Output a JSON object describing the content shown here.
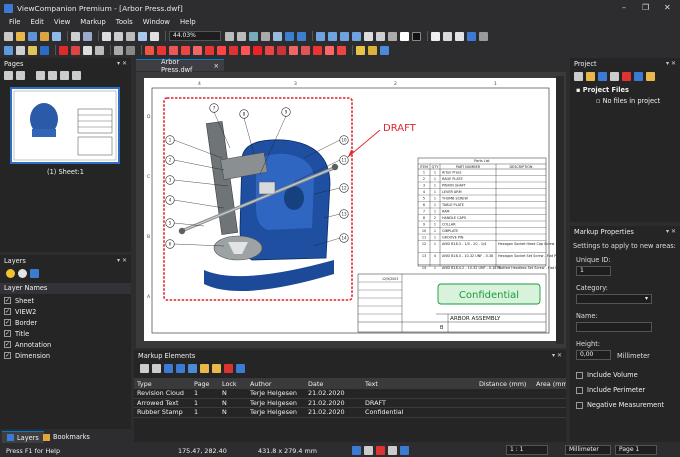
{
  "window": {
    "title": "ViewCompanion Premium - [Arbor Press.dwf]",
    "min": "–",
    "max": "❐",
    "close": "✕"
  },
  "menu": [
    "File",
    "Edit",
    "View",
    "Markup",
    "Tools",
    "Window",
    "Help"
  ],
  "toolbar": {
    "zoom_value": "44.03%"
  },
  "pages_panel": {
    "title": "Pages",
    "thumb_label": "(1) Sheet:1"
  },
  "layers_panel": {
    "title": "Layers",
    "column": "Layer Names",
    "layers": [
      "Sheet",
      "VIEW2",
      "Border",
      "Title",
      "Annotation",
      "Dimension"
    ]
  },
  "bottom_tabs": {
    "layers": "Layers",
    "bookmarks": "Bookmarks"
  },
  "document_tab": {
    "label": "Arbor Press.dwf",
    "close": "×"
  },
  "drawing": {
    "draft_label": "DRAFT",
    "confidential_label": "Confidential",
    "title_block_name": "ARBOR ASSEMBLY",
    "parts_list_title": "Parts List",
    "parts_headers": [
      "ITEM",
      "QTY",
      "PART NUMBER",
      "DESCRIPTION"
    ],
    "parts_rows": [
      [
        "1",
        "1",
        "Arbor Press",
        ""
      ],
      [
        "2",
        "1",
        "RAGE PLATE",
        ""
      ],
      [
        "3",
        "1",
        "PINION SHAFT",
        ""
      ],
      [
        "4",
        "1",
        "LEVER ARM",
        ""
      ],
      [
        "5",
        "1",
        "THUMB SCREW",
        ""
      ],
      [
        "6",
        "1",
        "TABLE PLATE",
        ""
      ],
      [
        "7",
        "1",
        "RAM",
        ""
      ],
      [
        "8",
        "2",
        "HANDLE CAPS",
        ""
      ],
      [
        "9",
        "1",
        "COLLAR",
        ""
      ],
      [
        "10",
        "1",
        "GIBPLATE",
        ""
      ],
      [
        "11",
        "1",
        "GROOVE PIN",
        ""
      ],
      [
        "12",
        "1",
        "ANSI B18.3 - 1/4 - 20 - 1/4",
        "Hexagon Socket Head Cap Screw"
      ],
      [
        "13",
        "4",
        "ANSI B18.3 - 10-32 UNF - 0.38",
        "Hexagon Socket Set Screw - Flat Point"
      ],
      [
        "14",
        "1",
        "ANSI B18.4.2 - 10-32 UNF - 0.1875",
        "Slotted Headless Set Screw - Flat Point - UNF"
      ]
    ],
    "balloons": [
      "1",
      "2",
      "3",
      "4",
      "5",
      "6",
      "7",
      "8",
      "9",
      "10",
      "11",
      "12",
      "13",
      "14"
    ],
    "border_letters": [
      "A",
      "B",
      "C",
      "D"
    ],
    "border_numbers": [
      "1",
      "2",
      "3",
      "4"
    ],
    "title_block_rev": "B",
    "title_block_date": "12/9/2003"
  },
  "markup_panel": {
    "title": "Markup Elements",
    "columns": [
      "Type",
      "Page",
      "Lock",
      "Author",
      "Date",
      "Text",
      "Distance (mm)",
      "Area (mm²)"
    ],
    "rows": [
      [
        "Revision Cloud",
        "1",
        "N",
        "Terje Helgesen",
        "21.02.2020",
        "",
        "",
        ""
      ],
      [
        "Arrowed Text",
        "1",
        "N",
        "Terje Helgesen",
        "21.02.2020",
        "DRAFT",
        "",
        ""
      ],
      [
        "Rubber Stamp",
        "1",
        "N",
        "Terje Helgesen",
        "21.02.2020",
        "Confidential",
        "",
        ""
      ]
    ]
  },
  "project_panel": {
    "title": "Project",
    "root": "Project Files",
    "child": "No files in project"
  },
  "properties_panel": {
    "title": "Markup Properties",
    "intro": "Settings to apply to new areas:",
    "unique_id_label": "Unique ID:",
    "unique_id_value": "1",
    "category_label": "Category:",
    "name_label": "Name:",
    "height_label": "Height:",
    "height_value": "0,00",
    "height_unit": "Millimeter",
    "checks": [
      "Include Volume",
      "Include Perimeter",
      "Negative Measurement"
    ]
  },
  "status": {
    "help": "Press F1 for Help",
    "coords": "175.47, 282.40",
    "size": "431.8 x 279.4 mm",
    "scale": "1 : 1",
    "unit": "Millimeter",
    "page": "Page 1"
  },
  "colors": {
    "accent": "#007acc",
    "bg": "#2d2d30",
    "panel": "#252526",
    "draft": "#e0262c",
    "stamp": "#1a9a3a"
  }
}
